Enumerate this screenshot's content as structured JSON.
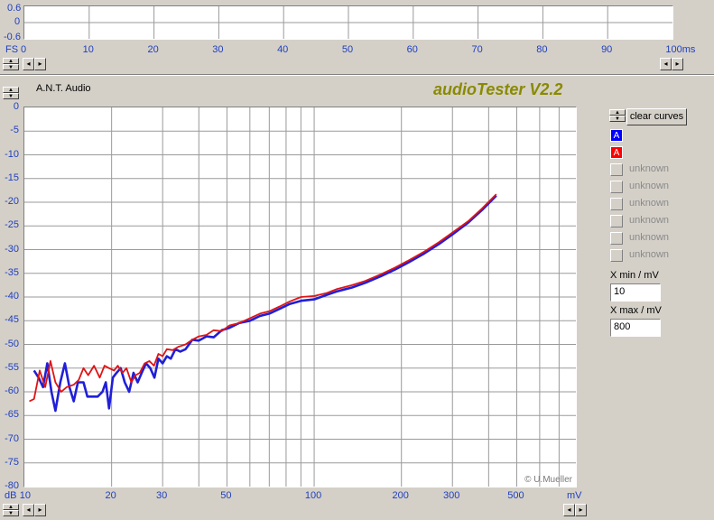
{
  "top_plot": {
    "y_ticks": [
      "0.6",
      "0",
      "-0.6"
    ],
    "y_unit": "FS",
    "x_ticks": [
      "0",
      "10",
      "20",
      "30",
      "40",
      "50",
      "60",
      "70",
      "80",
      "90",
      "100ms"
    ]
  },
  "header": {
    "brand": "A.N.T. Audio",
    "title": "audioTester V2.2"
  },
  "main_plot": {
    "y_unit": "dB",
    "y_ticks": [
      "0",
      "-5",
      "-10",
      "-15",
      "-20",
      "-25",
      "-30",
      "-35",
      "-40",
      "-45",
      "-50",
      "-55",
      "-60",
      "-65",
      "-70",
      "-75",
      "-80"
    ],
    "x_ticks": [
      "10",
      "20",
      "30",
      "50",
      "100",
      "200",
      "300",
      "500"
    ],
    "x_unit": "mV",
    "watermark": "© U.Mueller"
  },
  "sidebar": {
    "clear_label": "clear curves",
    "channels": [
      {
        "label": "A",
        "color": "#0000ff"
      },
      {
        "label": "A",
        "color": "#ff0000"
      }
    ],
    "unknown": [
      "unknown",
      "unknown",
      "unknown",
      "unknown",
      "unknown",
      "unknown"
    ],
    "xmin_label": "X min / mV",
    "xmin_value": "10",
    "xmax_label": "X max / mV",
    "xmax_value": "800"
  },
  "chart_data": {
    "type": "line",
    "xlim": [
      10,
      800
    ],
    "ylim": [
      -80,
      0
    ],
    "xscale": "log",
    "series": [
      {
        "color": "#1f1fd8",
        "points": [
          [
            10.8,
            -55.5
          ],
          [
            11.2,
            -57
          ],
          [
            11.6,
            -59
          ],
          [
            12,
            -54
          ],
          [
            12.4,
            -60
          ],
          [
            12.8,
            -64
          ],
          [
            13.3,
            -58
          ],
          [
            13.8,
            -54
          ],
          [
            14.3,
            -59
          ],
          [
            14.8,
            -62
          ],
          [
            15.3,
            -58
          ],
          [
            16,
            -58
          ],
          [
            16.5,
            -61
          ],
          [
            17.2,
            -61
          ],
          [
            17.9,
            -61
          ],
          [
            18.6,
            -60
          ],
          [
            19.1,
            -58
          ],
          [
            19.6,
            -63.5
          ],
          [
            20.2,
            -57
          ],
          [
            20.8,
            -56
          ],
          [
            21.5,
            -55
          ],
          [
            22.2,
            -58
          ],
          [
            23,
            -60
          ],
          [
            23.8,
            -56
          ],
          [
            24.6,
            -58
          ],
          [
            25.4,
            -56
          ],
          [
            26.3,
            -54
          ],
          [
            27.2,
            -55
          ],
          [
            28.1,
            -57
          ],
          [
            29,
            -53
          ],
          [
            30,
            -54
          ],
          [
            31,
            -52.5
          ],
          [
            32,
            -53
          ],
          [
            33.2,
            -51
          ],
          [
            34.5,
            -51.5
          ],
          [
            36,
            -51
          ],
          [
            38,
            -49
          ],
          [
            40,
            -49.2
          ],
          [
            42.5,
            -48.3
          ],
          [
            45,
            -48.5
          ],
          [
            48,
            -47
          ],
          [
            51,
            -46.5
          ],
          [
            55,
            -45.5
          ],
          [
            60,
            -45
          ],
          [
            65,
            -44
          ],
          [
            70,
            -43.5
          ],
          [
            76,
            -42.5
          ],
          [
            82,
            -41.5
          ],
          [
            90,
            -40.8
          ],
          [
            100,
            -40.5
          ],
          [
            110,
            -39.6
          ],
          [
            120,
            -38.8
          ],
          [
            135,
            -38
          ],
          [
            150,
            -37
          ],
          [
            170,
            -35.6
          ],
          [
            190,
            -34.2
          ],
          [
            210,
            -32.8
          ],
          [
            240,
            -30.8
          ],
          [
            270,
            -28.8
          ],
          [
            300,
            -26.8
          ],
          [
            340,
            -24.3
          ],
          [
            380,
            -21.6
          ],
          [
            425,
            -18.6
          ]
        ]
      },
      {
        "color": "#e01414",
        "points": [
          [
            10.4,
            -62
          ],
          [
            10.8,
            -61.5
          ],
          [
            11.3,
            -55.5
          ],
          [
            11.8,
            -59
          ],
          [
            12.3,
            -53.5
          ],
          [
            12.8,
            -58
          ],
          [
            13.4,
            -60
          ],
          [
            14,
            -59
          ],
          [
            14.8,
            -58.5
          ],
          [
            15.4,
            -57.5
          ],
          [
            16,
            -55
          ],
          [
            16.6,
            -56.5
          ],
          [
            17.4,
            -54.5
          ],
          [
            18.2,
            -57
          ],
          [
            18.9,
            -54.5
          ],
          [
            19.6,
            -55
          ],
          [
            20.4,
            -55.5
          ],
          [
            21,
            -54.5
          ],
          [
            21.8,
            -56
          ],
          [
            22.5,
            -55
          ],
          [
            23.4,
            -58
          ],
          [
            24.2,
            -56.5
          ],
          [
            25,
            -56
          ],
          [
            26,
            -54
          ],
          [
            27,
            -53.5
          ],
          [
            28,
            -54.5
          ],
          [
            29,
            -52
          ],
          [
            30,
            -52.5
          ],
          [
            31,
            -51
          ],
          [
            32.5,
            -51.2
          ],
          [
            34,
            -50.5
          ],
          [
            36,
            -50
          ],
          [
            38,
            -49
          ],
          [
            40,
            -48.3
          ],
          [
            42.5,
            -48
          ],
          [
            45,
            -47
          ],
          [
            48,
            -47.2
          ],
          [
            51,
            -46
          ],
          [
            55,
            -45.5
          ],
          [
            60,
            -44.5
          ],
          [
            65,
            -43.5
          ],
          [
            70,
            -43
          ],
          [
            76,
            -42
          ],
          [
            82,
            -41
          ],
          [
            90,
            -40
          ],
          [
            100,
            -39.8
          ],
          [
            110,
            -39.2
          ],
          [
            120,
            -38.3
          ],
          [
            135,
            -37.5
          ],
          [
            150,
            -36.6
          ],
          [
            170,
            -35.2
          ],
          [
            190,
            -33.8
          ],
          [
            210,
            -32.4
          ],
          [
            240,
            -30.4
          ],
          [
            270,
            -28.4
          ],
          [
            300,
            -26.4
          ],
          [
            340,
            -24
          ],
          [
            380,
            -21.3
          ],
          [
            425,
            -18.3
          ]
        ]
      }
    ]
  }
}
